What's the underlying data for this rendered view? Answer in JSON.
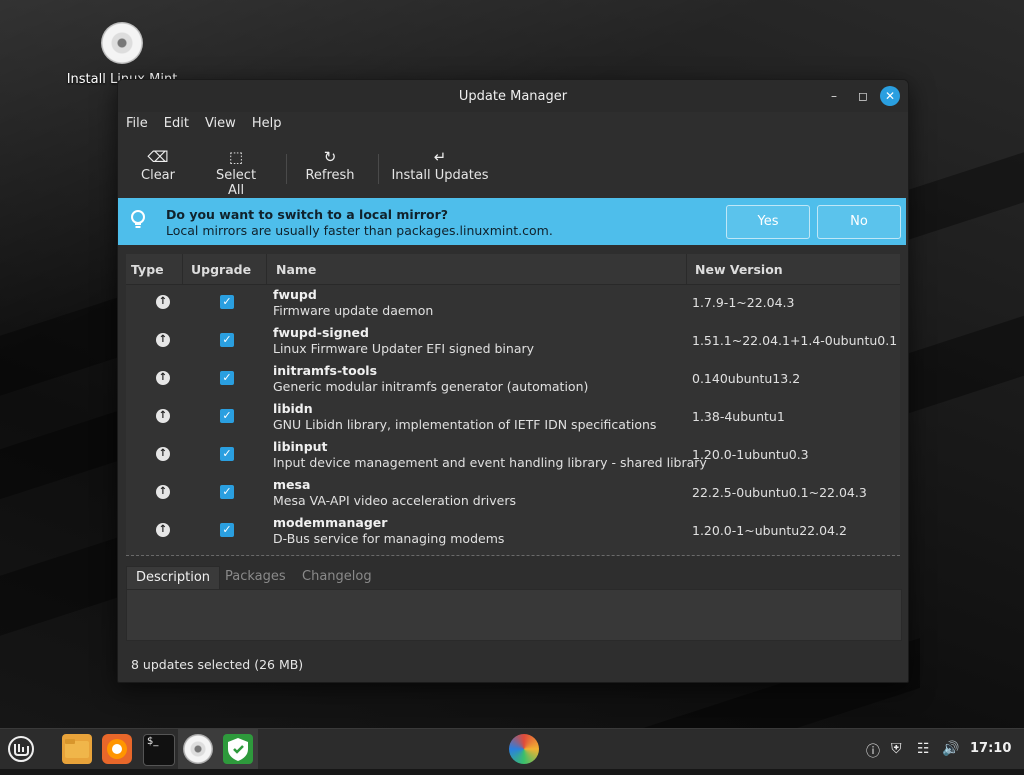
{
  "desktop": {
    "icons": [
      {
        "label": "Install Linux Mint",
        "icon": "disc-icon"
      }
    ]
  },
  "window": {
    "title": "Update Manager",
    "controls": {
      "minimize": "minimize-icon",
      "maximize": "maximize-icon",
      "close": "close-icon"
    }
  },
  "menu": {
    "items": [
      "File",
      "Edit",
      "View",
      "Help"
    ]
  },
  "toolbar": {
    "clear_label": "Clear",
    "select_all_label": "Select All",
    "refresh_label": "Refresh",
    "install_label": "Install Updates"
  },
  "banner": {
    "title": "Do you want to switch to a local mirror?",
    "subtitle": "Local mirrors are usually faster than packages.linuxmint.com.",
    "yes_label": "Yes",
    "no_label": "No",
    "icon": "lightbulb-icon",
    "color": "#4ebeeb"
  },
  "table": {
    "columns": [
      "Type",
      "Upgrade",
      "Name",
      "New Version"
    ],
    "rows": [
      {
        "name": "fwupd",
        "description": "Firmware update daemon",
        "version": "1.7.9-1~22.04.3",
        "checked": true
      },
      {
        "name": "fwupd-signed",
        "description": "Linux Firmware Updater EFI signed binary",
        "version": "1.51.1~22.04.1+1.4-0ubuntu0.1",
        "checked": true
      },
      {
        "name": "initramfs-tools",
        "description": "Generic modular initramfs generator (automation)",
        "version": "0.140ubuntu13.2",
        "checked": true
      },
      {
        "name": "libidn",
        "description": "GNU Libidn library, implementation of IETF IDN specifications",
        "version": "1.38-4ubuntu1",
        "checked": true
      },
      {
        "name": "libinput",
        "description": "Input device management and event handling library - shared library",
        "version": "1.20.0-1ubuntu0.3",
        "checked": true
      },
      {
        "name": "mesa",
        "description": "Mesa VA-API video acceleration drivers",
        "version": "22.2.5-0ubuntu0.1~22.04.3",
        "checked": true
      },
      {
        "name": "modemmanager",
        "description": "D-Bus service for managing modems",
        "version": "1.20.0-1~ubuntu22.04.2",
        "checked": true
      }
    ]
  },
  "tabs": [
    "Description",
    "Packages",
    "Changelog"
  ],
  "status": "8 updates selected (26 MB)",
  "taskbar": {
    "apps": [
      "mint-menu-icon",
      "files-icon",
      "firefox-icon",
      "terminal-icon",
      "disc-icon",
      "update-manager-icon"
    ],
    "tray": [
      "notification-icon",
      "shield-icon",
      "network-icon",
      "volume-icon"
    ],
    "clock": "17:10"
  },
  "accent_color": "#2a9fe0"
}
